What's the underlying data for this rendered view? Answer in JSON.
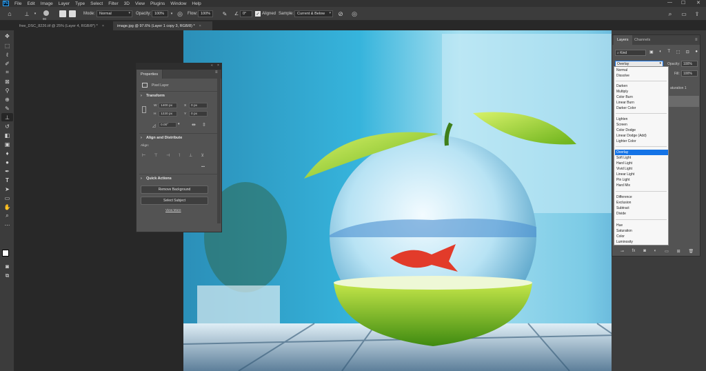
{
  "app": {
    "logo": "Ps"
  },
  "menu": [
    "File",
    "Edit",
    "Image",
    "Layer",
    "Type",
    "Select",
    "Filter",
    "3D",
    "View",
    "Plugins",
    "Window",
    "Help"
  ],
  "window_controls": {
    "minimize": "—",
    "maximize": "☐",
    "close": "✕"
  },
  "options_bar": {
    "brush_size": "90",
    "mode_label": "Mode:",
    "mode_value": "Normal",
    "opacity_label": "Opacity:",
    "opacity_value": "100%",
    "flow_label": "Flow:",
    "flow_value": "100%",
    "angle_value": "0°",
    "aligned_label": "Aligned",
    "sample_label": "Sample:",
    "sample_value": "Current & Below"
  },
  "tabs": [
    {
      "label": "free_DSC_8226.tif @ 25% (Layer 4, RGB/8*) *",
      "close": "×"
    },
    {
      "label": "image.jpg @ 97.6% (Layer 1 copy 3, RGB/8) *",
      "close": "×"
    }
  ],
  "properties": {
    "title": "Properties",
    "layer_type": "Pixel Layer",
    "transform_title": "Transform",
    "w_label": "W",
    "w_value": "1400 px",
    "h_label": "H",
    "h_value": "1220 px",
    "x_label": "X",
    "x_value": "0 px",
    "y_label": "Y",
    "y_value": "0 px",
    "angle_value": "0.00°",
    "align_title": "Align and Distribute",
    "align_label": "Align:",
    "more": "•••",
    "qa_title": "Quick Actions",
    "remove_bg": "Remove Background",
    "select_subject": "Select Subject",
    "view_more": "View More"
  },
  "layers_panel": {
    "tabs": [
      "Layers",
      "Channels"
    ],
    "kind_label": "Kind",
    "blend_value": "Overlay",
    "opacity_label": "Opacity:",
    "opacity_value": "100%",
    "fill_label": "Fill:",
    "fill_value": "100%",
    "layer_name_fragment": "aturation 1"
  },
  "blend_modes": {
    "group1": [
      "Normal",
      "Dissolve"
    ],
    "group2": [
      "Darken",
      "Multiply",
      "Color Burn",
      "Linear Burn",
      "Darker Color"
    ],
    "group3": [
      "Lighten",
      "Screen",
      "Color Dodge",
      "Linear Dodge (Add)",
      "Lighter Color"
    ],
    "group4": [
      "Overlay",
      "Soft Light",
      "Hard Light",
      "Vivid Light",
      "Linear Light",
      "Pin Light",
      "Hard Mix"
    ],
    "group5": [
      "Difference",
      "Exclusion",
      "Subtract",
      "Divide"
    ],
    "group6": [
      "Hue",
      "Saturation",
      "Color",
      "Luminosity"
    ],
    "selected": "Overlay"
  },
  "colors": {
    "selection_blue": "#1473e6",
    "panel_gray": "#535353",
    "ui_dark": "#3c3c3c"
  }
}
